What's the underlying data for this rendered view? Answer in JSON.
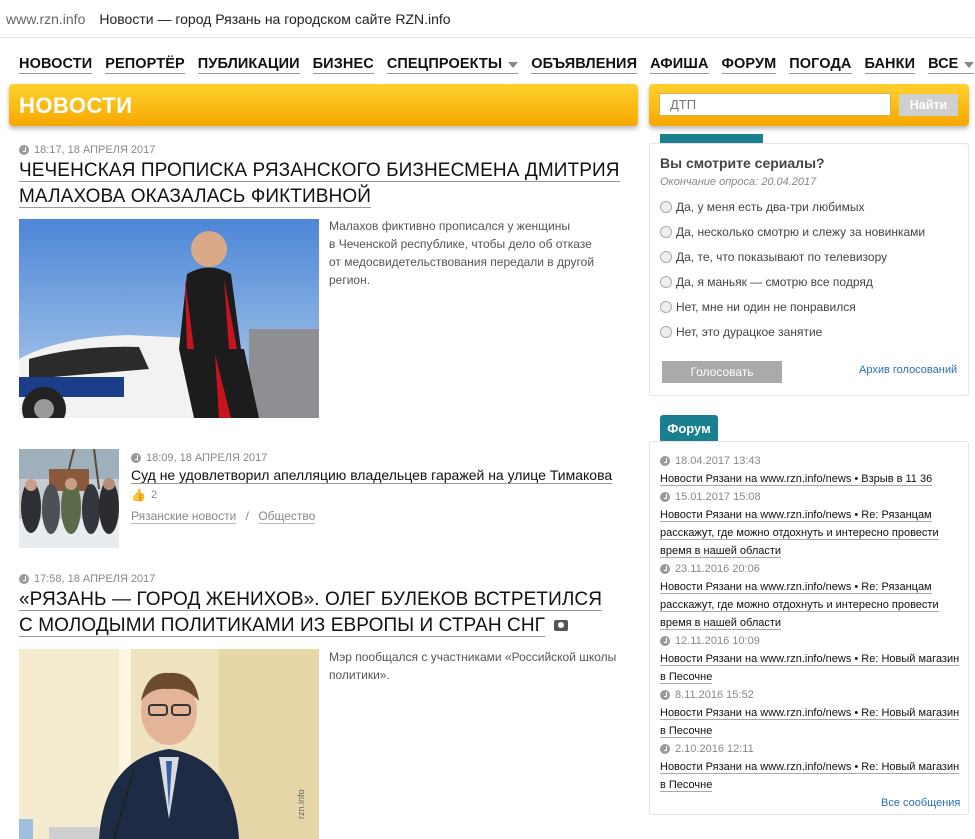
{
  "titlebar": {
    "host": "www.rzn.info",
    "title": "Новости — город Рязань на городском сайте RZN.info"
  },
  "nav": [
    "НОВОСТИ",
    "РЕПОРТЁР",
    "ПУБЛИКАЦИИ",
    "БИЗНЕС",
    "СПЕЦПРОЕКТЫ",
    "ОБЪЯВЛЕНИЯ",
    "АФИША",
    "ФОРУМ",
    "ПОГОДА",
    "БАНКИ",
    "ВСЕ"
  ],
  "section_title": "НОВОСТИ",
  "search": {
    "placeholder": "ДТП",
    "button": "Найти"
  },
  "articles": [
    {
      "time": "18:17, 18 АПРЕЛЯ 2017",
      "title_line1": "ЧЕЧЕНСКАЯ ПРОПИСКА РЯЗАНСКОГО БИЗНЕСМЕНА ДМИТРИЯ",
      "title_line2": "МАЛАХОВА ОКАЗАЛАСЬ ФИКТИВНОЙ",
      "lead_lines": [
        "Малахов фиктивно прописался у женщины",
        "в Чеченской республике, чтобы дело об отказе",
        "от медосвидетельствования передали в другой",
        "регион."
      ]
    },
    {
      "time": "18:09, 18 АПРЕЛЯ 2017",
      "title": "Суд не удовлетворил апелляцию владельцев гаражей на улице Тимакова",
      "likes": "2",
      "tag1": "Рязанские новости",
      "sep": "/",
      "tag2": "Общество"
    },
    {
      "time": "17:58, 18 АПРЕЛЯ 2017",
      "title_line1": "«РЯЗАНЬ — ГОРОД ЖЕНИХОВ». ОЛЕГ БУЛЕКОВ ВСТРЕТИЛСЯ",
      "title_line2": "С МОЛОДЫМИ ПОЛИТИКАМИ ИЗ ЕВРОПЫ И СТРАН СНГ",
      "lead_lines": [
        "Мэр пообщался с участниками «Российской школы",
        "политики»."
      ],
      "watermark": "rzn.info"
    }
  ],
  "poll": {
    "question": "Вы смотрите сериалы?",
    "end": "Окончание опроса: 20.04.2017",
    "options": [
      "Да, у меня есть два-три любимых",
      "Да, несколько смотрю и слежу за новинками",
      "Да, те, что показывают по телевизору",
      "Да, я маньяк — смотрю все подряд",
      "Нет, мне ни один не понравился",
      "Нет, это дурацкое занятие"
    ],
    "vote": "Голосовать",
    "archive": "Архив голосований"
  },
  "forum": {
    "tab": "Форум",
    "items": [
      {
        "time": "18.04.2017 13:43",
        "lines": [
          "Новости Рязани на www.rzn.info/news • Взрыв в 11 36"
        ]
      },
      {
        "time": "15.01.2017 15:08",
        "lines": [
          "Новости Рязани на www.rzn.info/news • Re: Рязанцам",
          "расскажут, где можно отдохнуть и интересно провести",
          "время в нашей области"
        ]
      },
      {
        "time": "23.11.2016 20:06",
        "lines": [
          "Новости Рязани на www.rzn.info/news • Re: Рязанцам",
          "расскажут, где можно отдохнуть и интересно провести",
          "время в нашей области"
        ]
      },
      {
        "time": "12.11.2016 10:09",
        "lines": [
          "Новости Рязани на www.rzn.info/news • Re: Новый магазин",
          "в Песочне"
        ]
      },
      {
        "time": "8.11.2016 15:52",
        "lines": [
          "Новости Рязани на www.rzn.info/news • Re: Новый магазин",
          "в Песочне"
        ]
      },
      {
        "time": "2.10.2016 12:11",
        "lines": [
          "Новости Рязани на www.rzn.info/news • Re: Новый магазин",
          "в Песочне"
        ]
      }
    ],
    "all": "Все сообщения"
  }
}
